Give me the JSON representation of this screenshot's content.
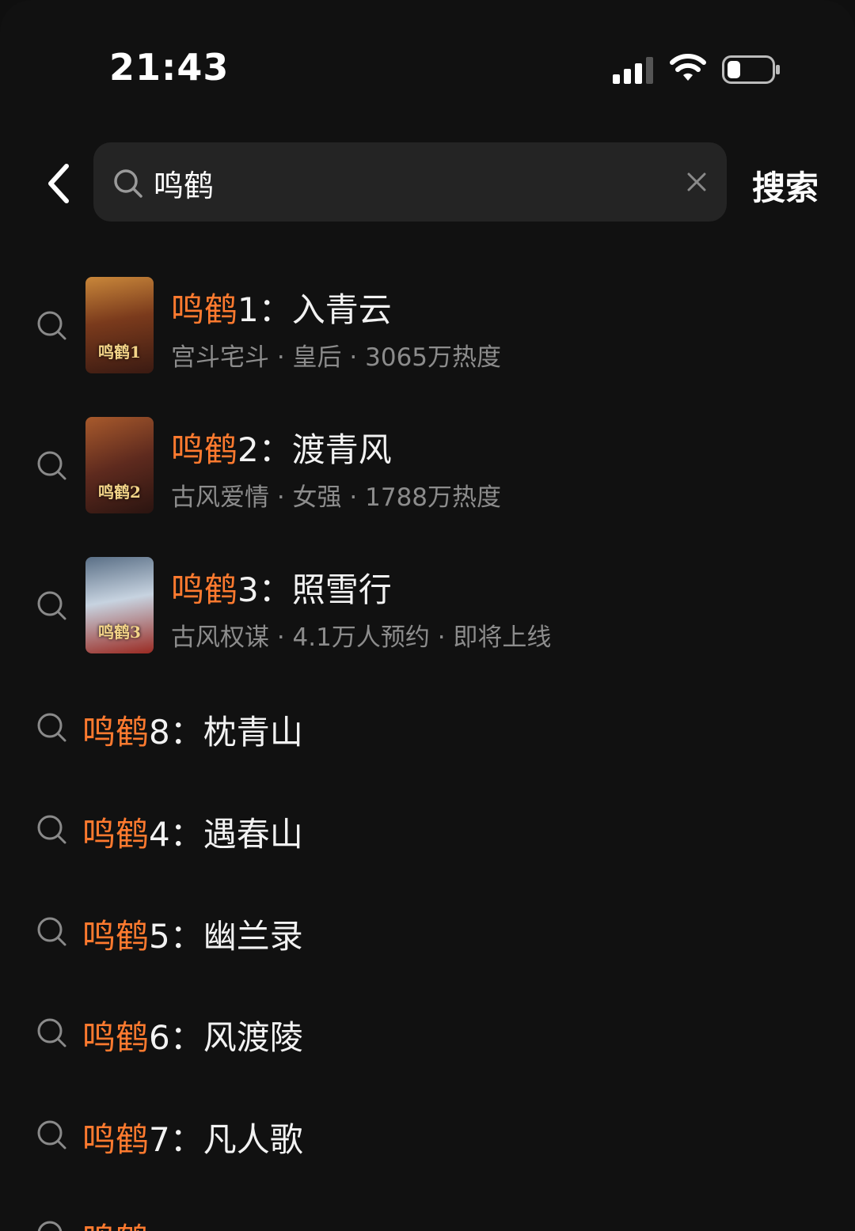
{
  "status_bar": {
    "time": "21:43",
    "icons": [
      "signal-icon",
      "wifi-icon",
      "battery-icon"
    ]
  },
  "header": {
    "back_icon": "chevron-left-icon",
    "search": {
      "value": "鸣鹤",
      "icon": "search-icon",
      "clear_icon": "close-icon"
    },
    "search_button": "搜索"
  },
  "rich_results": [
    {
      "highlight": "鸣鹤",
      "rest": "1：入青云",
      "subtitle": "宫斗宅斗 · 皇后 · 3065万热度",
      "cover_text": "鸣鹤1",
      "cover_colors": [
        "#3a1a12",
        "#7a3a1c",
        "#c9873a"
      ]
    },
    {
      "highlight": "鸣鹤",
      "rest": "2：渡青风",
      "subtitle": "古风爱情 · 女强 · 1788万热度",
      "cover_text": "鸣鹤2",
      "cover_colors": [
        "#2a1410",
        "#5e2a1e",
        "#a85a2c"
      ]
    },
    {
      "highlight": "鸣鹤",
      "rest": "3：照雪行",
      "subtitle": "古风权谋 · 4.1万人预约 · 即将上线",
      "cover_text": "鸣鹤3",
      "cover_colors": [
        "#5a6f86",
        "#c7d3e0",
        "#9a2a22"
      ]
    }
  ],
  "simple_results": [
    {
      "highlight": "鸣鹤",
      "rest": "8：枕青山"
    },
    {
      "highlight": "鸣鹤",
      "rest": "4：遇春山"
    },
    {
      "highlight": "鸣鹤",
      "rest": "5：幽兰录"
    },
    {
      "highlight": "鸣鹤",
      "rest": "6：风渡陵"
    },
    {
      "highlight": "鸣鹤",
      "rest": "7：凡人歌"
    },
    {
      "highlight": "鸣鹤",
      "rest": ""
    }
  ],
  "colors": {
    "background": "#111111",
    "highlight": "#ff7a2f",
    "subtitle": "#8c8c8c",
    "search_box": "#242424"
  }
}
